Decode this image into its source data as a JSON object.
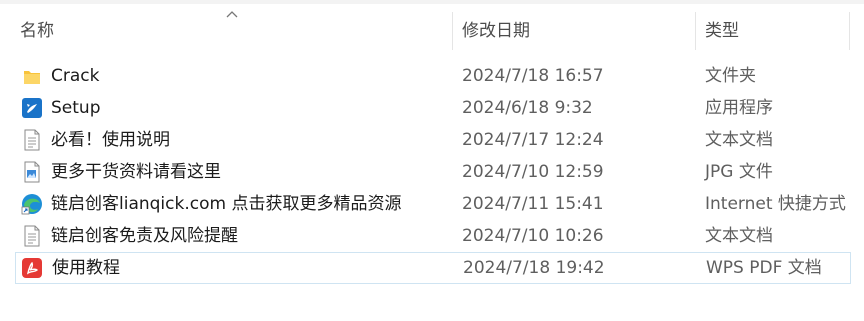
{
  "columns": {
    "name": "名称",
    "date": "修改日期",
    "type": "类型"
  },
  "files": [
    {
      "name": "Crack",
      "date": "2024/7/18 16:57",
      "type": "文件夹",
      "icon": "folder-icon"
    },
    {
      "name": "Setup",
      "date": "2024/6/18 9:32",
      "type": "应用程序",
      "icon": "app-icon"
    },
    {
      "name": "必看！使用说明",
      "date": "2024/7/17 12:24",
      "type": "文本文档",
      "icon": "text-document-icon"
    },
    {
      "name": "更多干货资料请看这里",
      "date": "2024/7/10 12:59",
      "type": "JPG 文件",
      "icon": "image-file-icon"
    },
    {
      "name": "链启创客lianqick.com 点击获取更多精品资源",
      "date": "2024/7/11 15:41",
      "type": "Internet 快捷方式",
      "icon": "edge-shortcut-icon"
    },
    {
      "name": "链启创客免责及风险提醒",
      "date": "2024/7/10 10:26",
      "type": "文本文档",
      "icon": "text-document-icon"
    },
    {
      "name": "使用教程",
      "date": "2024/7/18 19:42",
      "type": "WPS PDF 文档",
      "icon": "wps-pdf-icon"
    }
  ],
  "colors": {
    "folder": "#f8c33b",
    "app_accent": "#1a73c8",
    "pdf_red": "#e53935",
    "selection_border": "#cfe4f2"
  }
}
